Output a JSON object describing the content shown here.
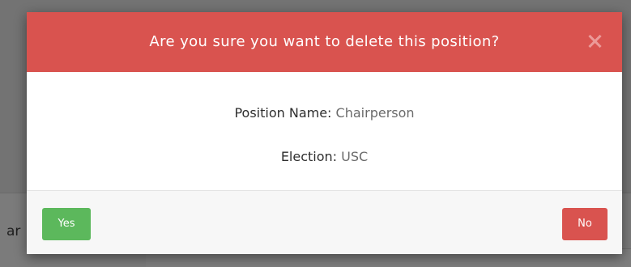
{
  "background": {
    "partial_text": "ar"
  },
  "modal": {
    "title": "Are you sure you want to delete this position?",
    "close_icon": "close-icon",
    "position_label": "Position Name:",
    "position_value": "Chairperson",
    "election_label": "Election:",
    "election_value": "USC",
    "yes_label": "Yes",
    "no_label": "No"
  },
  "colors": {
    "header": "#d9534f",
    "yes_button": "#5cb85c",
    "no_button": "#d9534f"
  }
}
